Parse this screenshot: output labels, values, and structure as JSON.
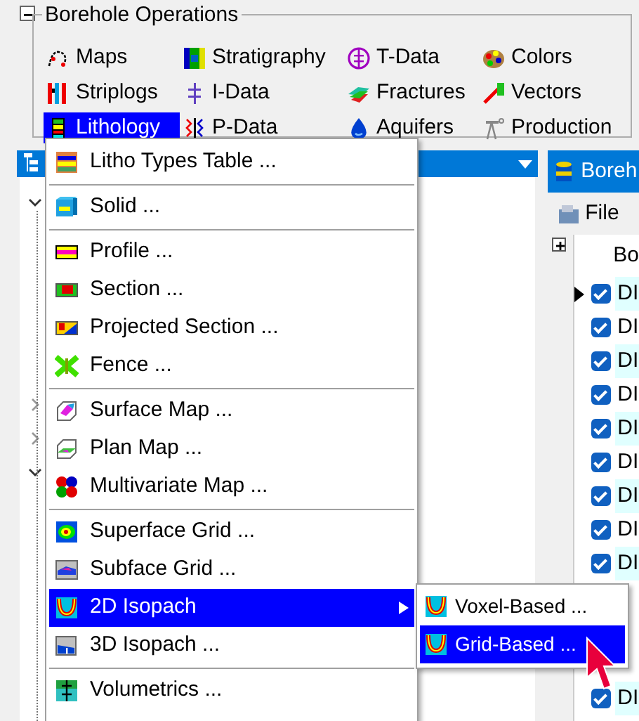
{
  "group": {
    "title": "Borehole Operations"
  },
  "operations": [
    {
      "label": "Maps",
      "selected": false
    },
    {
      "label": "Stratigraphy",
      "selected": false
    },
    {
      "label": "T-Data",
      "selected": false
    },
    {
      "label": "Colors",
      "selected": false
    },
    {
      "label": "Striplogs",
      "selected": false
    },
    {
      "label": "I-Data",
      "selected": false
    },
    {
      "label": "Fractures",
      "selected": false
    },
    {
      "label": "Vectors",
      "selected": false
    },
    {
      "label": "Lithology",
      "selected": true
    },
    {
      "label": "P-Data",
      "selected": false
    },
    {
      "label": "Aquifers",
      "selected": false
    },
    {
      "label": "Production",
      "selected": false
    }
  ],
  "tree": {
    "toggles": [
      {
        "expanded": true
      },
      {
        "expanded": false
      },
      {
        "expanded": false
      },
      {
        "expanded": true
      }
    ]
  },
  "borehole_panel": {
    "title": "Boreh",
    "toolbar": [
      "File"
    ],
    "grid_header": "Bo",
    "rows": [
      {
        "checked": true,
        "text": "DI",
        "current": true
      },
      {
        "checked": true,
        "text": "DI",
        "current": false
      },
      {
        "checked": true,
        "text": "DI",
        "current": false
      },
      {
        "checked": true,
        "text": "DI",
        "current": false
      },
      {
        "checked": true,
        "text": "DI",
        "current": false
      },
      {
        "checked": true,
        "text": "DI",
        "current": false
      },
      {
        "checked": true,
        "text": "DI",
        "current": false
      },
      {
        "checked": true,
        "text": "DI",
        "current": false
      },
      {
        "checked": true,
        "text": "DI",
        "current": false
      },
      {
        "checked": true,
        "text": "DI",
        "current": false
      }
    ]
  },
  "menu": {
    "items": [
      {
        "kind": "item",
        "label": "Litho Types Table ...",
        "selected": false,
        "submenu": false
      },
      {
        "kind": "separator"
      },
      {
        "kind": "item",
        "label": "Solid ...",
        "selected": false,
        "submenu": false
      },
      {
        "kind": "separator"
      },
      {
        "kind": "item",
        "label": "Profile ...",
        "selected": false,
        "submenu": false
      },
      {
        "kind": "item",
        "label": "Section ...",
        "selected": false,
        "submenu": false
      },
      {
        "kind": "item",
        "label": "Projected Section ...",
        "selected": false,
        "submenu": false
      },
      {
        "kind": "item",
        "label": "Fence ...",
        "selected": false,
        "submenu": false
      },
      {
        "kind": "separator"
      },
      {
        "kind": "item",
        "label": "Surface Map ...",
        "selected": false,
        "submenu": false
      },
      {
        "kind": "item",
        "label": "Plan Map ...",
        "selected": false,
        "submenu": false
      },
      {
        "kind": "item",
        "label": "Multivariate Map ...",
        "selected": false,
        "submenu": false
      },
      {
        "kind": "separator"
      },
      {
        "kind": "item",
        "label": "Superface Grid ...",
        "selected": false,
        "submenu": false
      },
      {
        "kind": "item",
        "label": "Subface Grid ...",
        "selected": false,
        "submenu": false
      },
      {
        "kind": "item",
        "label": "2D Isopach",
        "selected": true,
        "submenu": true
      },
      {
        "kind": "item",
        "label": "3D Isopach ...",
        "selected": false,
        "submenu": false
      },
      {
        "kind": "separator"
      },
      {
        "kind": "item",
        "label": "Volumetrics ...",
        "selected": false,
        "submenu": false
      }
    ]
  },
  "submenu": {
    "items": [
      {
        "label": "Voxel-Based ...",
        "selected": false
      },
      {
        "label": "Grid-Based ...",
        "selected": true
      }
    ]
  }
}
